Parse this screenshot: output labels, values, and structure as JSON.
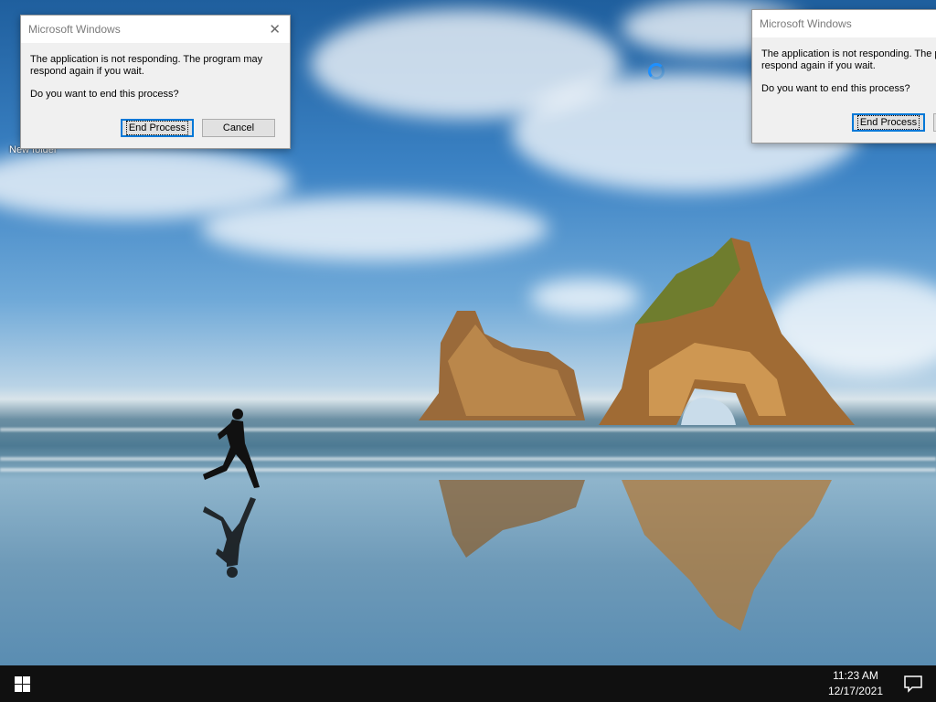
{
  "desktop": {
    "icon_label": "New folder"
  },
  "dialog_left": {
    "title": "Microsoft Windows",
    "message": "The application is not responding. The program may respond again if you wait.",
    "question": "Do you want to end this process?",
    "end_label": "End Process",
    "cancel_label": "Cancel"
  },
  "dialog_right": {
    "title": "Microsoft Windows",
    "message_line1": "The application is not responding. The p",
    "message_line2": "respond again if you wait.",
    "question": "Do you want to end this process?",
    "end_label": "End Process"
  },
  "taskbar": {
    "time": "11:23 AM",
    "date": "12/17/2021"
  },
  "icons": {
    "start": "windows-logo-icon",
    "notifications": "action-center-icon",
    "busy": "busy-spinner-icon"
  },
  "colors": {
    "accent": "#0078d7",
    "taskbar": "#101010"
  }
}
